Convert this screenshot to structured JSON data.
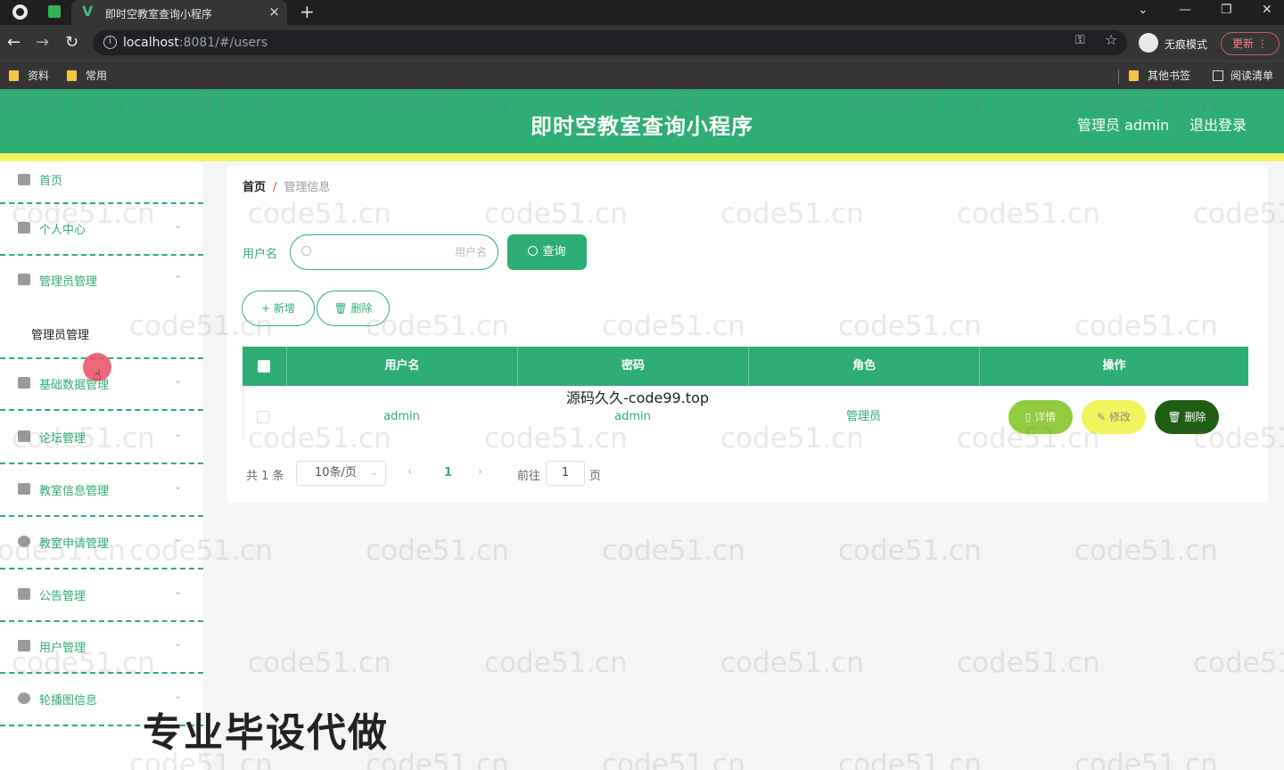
{
  "browser": {
    "tab_title": "即时空教室查询小程序",
    "tab_close": "×",
    "new_tab": "+",
    "url_host": "localhost",
    "url_rest": ":8081/#/users",
    "incognito_label": "无痕模式",
    "update_label": "更新",
    "bookmarks": [
      "资料",
      "常用"
    ],
    "bookmarks_right": [
      "其他书签",
      "阅读清单"
    ]
  },
  "header": {
    "title": "即时空教室查询小程序",
    "admin_label": "管理员 admin",
    "logout_label": "退出登录"
  },
  "sidebar": {
    "items": [
      {
        "label": "首页",
        "icon": "home-icon"
      },
      {
        "label": "个人中心",
        "icon": "user-icon"
      },
      {
        "label": "管理员管理",
        "icon": "mic-icon"
      },
      {
        "label": "基础数据管理",
        "icon": "briefcase-icon"
      },
      {
        "label": "论坛管理",
        "icon": "crop-icon"
      },
      {
        "label": "教室信息管理",
        "icon": "chat-icon"
      },
      {
        "label": "教室申请管理",
        "icon": "globe-icon"
      },
      {
        "label": "公告管理",
        "icon": "ticket-icon"
      },
      {
        "label": "用户管理",
        "icon": "monitor-icon"
      },
      {
        "label": "轮播图信息",
        "icon": "power-icon"
      }
    ],
    "sub_item": "管理员管理"
  },
  "breadcrumb": {
    "home": "首页",
    "separator": "/",
    "current": "管理信息"
  },
  "search": {
    "label": "用户名",
    "placeholder": "用户名",
    "value": "",
    "query_label": "查询"
  },
  "actions": {
    "add_label": "+ 新增",
    "delete_label": "删除"
  },
  "table": {
    "columns": [
      "用户名",
      "密码",
      "角色",
      "操作"
    ],
    "rows": [
      {
        "username": "admin",
        "password": "admin",
        "role": "管理员",
        "ops": [
          "详情",
          "修改",
          "删除"
        ]
      }
    ]
  },
  "pagination": {
    "total": "共 1 条",
    "page_size": "10条/页",
    "prev": "‹",
    "current": "1",
    "next": "›",
    "goto_label": "前往",
    "goto_value": "1",
    "page_suffix": "页"
  },
  "overlays": {
    "code_watermark": "源码久久-code99.top",
    "bottom_text": "专业毕设代做",
    "watermark": "code51.cn"
  },
  "colors": {
    "primary": "#2ead75",
    "accent_yellow": "#f3f35e",
    "detail_btn": "#8fcc3e",
    "delete_btn": "#1f5e12"
  }
}
